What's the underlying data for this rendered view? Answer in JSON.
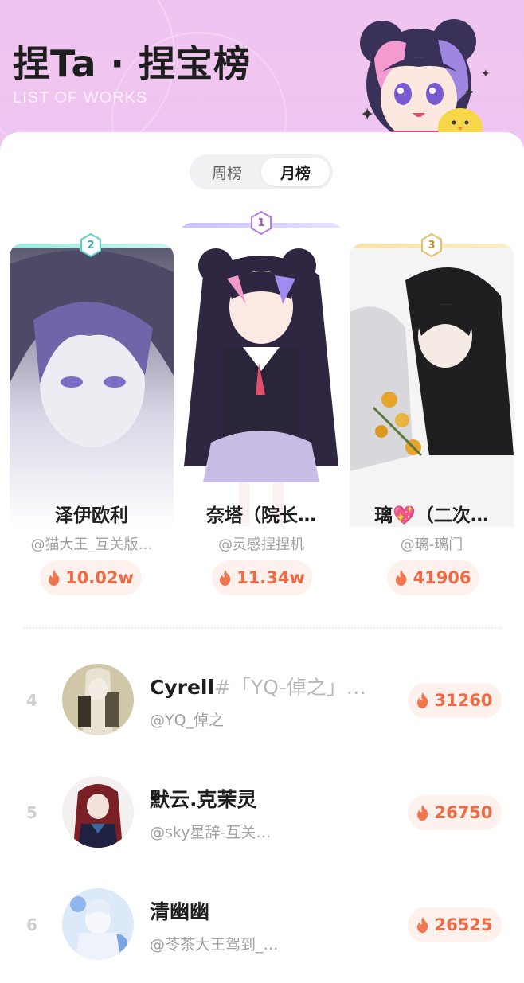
{
  "header": {
    "title": "捏Ta · 捏宝榜",
    "subtitle": "LIST OF WORKS"
  },
  "tabs": [
    {
      "label": "周榜",
      "active": false
    },
    {
      "label": "月榜",
      "active": true
    }
  ],
  "podium": [
    {
      "rank": "1",
      "name": "奈塔（院长…",
      "author": "@灵感捏捏机",
      "heat": "11.34w",
      "accent": "#b9b4ff"
    },
    {
      "rank": "2",
      "name": "泽伊欧利",
      "author": "@猫大王_互关版…",
      "heat": "10.02w",
      "accent": "#7fe0d8"
    },
    {
      "rank": "3",
      "name": "璃💖（二次…",
      "author": "@璃-璃门",
      "heat": "41906",
      "accent": "#f3d98a"
    }
  ],
  "list": [
    {
      "rank": "4",
      "name_main": "Cyrell",
      "name_tail": "#「YQ-倬之」…",
      "author": "@YQ_倬之",
      "heat": "31260"
    },
    {
      "rank": "5",
      "name_main": "默云.克茉灵",
      "name_tail": "",
      "author": "@sky星辞-互关…",
      "heat": "26750"
    },
    {
      "rank": "6",
      "name_main": "清幽幽",
      "name_tail": "",
      "author": "@苓茶大王驾到_…",
      "heat": "26525"
    }
  ],
  "colors": {
    "header_bg": "#f0c4f0",
    "heat_text": "#ef6a42",
    "heat_bg": "#fdf1ee",
    "rank_gray": "#cfcfcf"
  },
  "icons": [
    "fire-icon",
    "rank-badge-icon",
    "sparkle-icon"
  ]
}
